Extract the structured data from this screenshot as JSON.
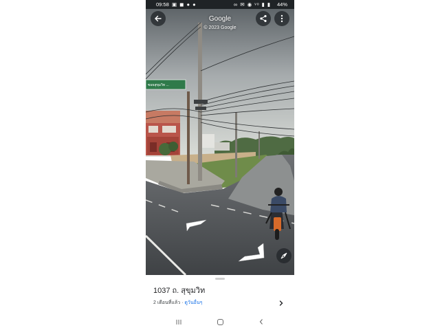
{
  "status_bar": {
    "time": "09:58",
    "notification_icons": "▣ ◼ ● ●",
    "system_icons": "∞ ✉ ◉ ᵛᵒ ▮ ▮",
    "battery": "44%"
  },
  "street_view": {
    "title": "Google",
    "copyright": "© 2023 Google",
    "street_sign": "ซอยสุขุมวิท ..."
  },
  "bottom_sheet": {
    "address": "1037 ถ. สุขุมวิท",
    "date": "2 เดือนที่แล้ว",
    "separator": "·",
    "more_link": "ดูวันอื่นๆ"
  },
  "colors": {
    "accent": "#1a73e8",
    "statusbar": "#1f2326"
  },
  "icons": {
    "back": "arrow-left-icon",
    "share": "share-icon",
    "more": "more-vert-icon",
    "compass": "compass-icon",
    "nav": [
      "recent-apps-icon",
      "home-icon",
      "back-nav-icon"
    ]
  }
}
